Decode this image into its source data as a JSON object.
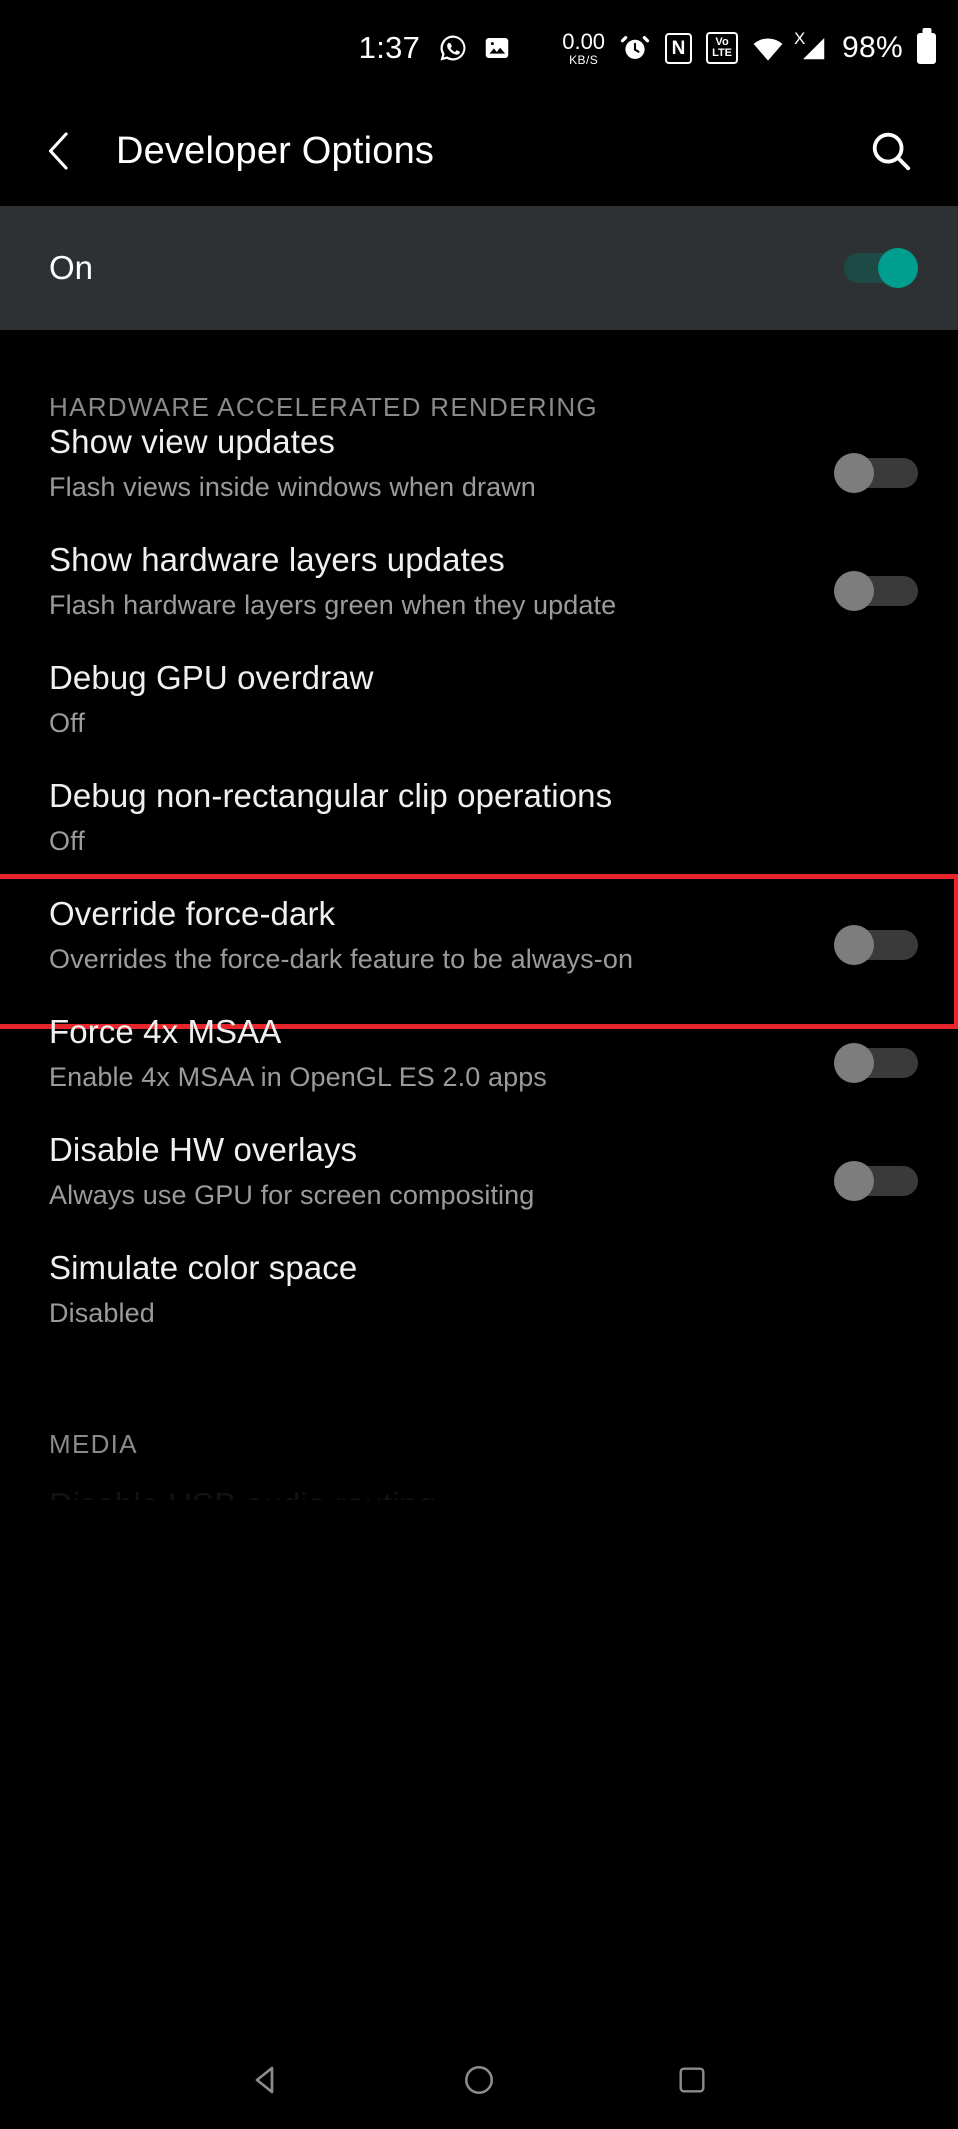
{
  "status_bar": {
    "time": "1:37",
    "net_speed_value": "0.00",
    "net_speed_unit": "KB/S",
    "nfc_label": "N",
    "volte_top": "Vo",
    "volte_bottom": "LTE",
    "signal_x": "X",
    "battery_percent": "98%",
    "icons": [
      "whatsapp-icon",
      "gallery-icon",
      "alarm-icon",
      "nfc-icon",
      "volte-icon",
      "wifi-icon",
      "cellular-signal-icon",
      "battery-icon"
    ]
  },
  "app_bar": {
    "back_icon": "back-chevron-icon",
    "title": "Developer Options",
    "search_icon": "search-icon"
  },
  "master_switch": {
    "label": "On",
    "state": "on",
    "track_color": "#1d4a45",
    "thumb_color": "#009e8e",
    "row_background": "#2e3133"
  },
  "sections": [
    {
      "header": "HARDWARE ACCELERATED RENDERING",
      "items": [
        {
          "title": "Show view updates",
          "subtitle": "Flash views inside windows when drawn",
          "control": "toggle",
          "state": "off",
          "highlighted": false
        },
        {
          "title": "Show hardware layers updates",
          "subtitle": "Flash hardware layers green when they update",
          "control": "toggle",
          "state": "off",
          "highlighted": false
        },
        {
          "title": "Debug GPU overdraw",
          "subtitle": "Off",
          "control": "none",
          "state": "",
          "highlighted": false
        },
        {
          "title": "Debug non-rectangular clip operations",
          "subtitle": "Off",
          "control": "none",
          "state": "",
          "highlighted": false
        },
        {
          "title": "Override force-dark",
          "subtitle": "Overrides the force-dark feature to be always-on",
          "control": "toggle",
          "state": "off",
          "highlighted": true
        },
        {
          "title": "Force 4x MSAA",
          "subtitle": "Enable 4x MSAA in OpenGL ES 2.0 apps",
          "control": "toggle",
          "state": "off",
          "highlighted": false
        },
        {
          "title": "Disable HW overlays",
          "subtitle": "Always use GPU for screen compositing",
          "control": "toggle",
          "state": "off",
          "highlighted": false
        },
        {
          "title": "Simulate color space",
          "subtitle": "Disabled",
          "control": "none",
          "state": "",
          "highlighted": false
        }
      ]
    },
    {
      "header": "MEDIA",
      "items": [
        {
          "title": "Disable USB audio routing",
          "subtitle": "",
          "control": "none",
          "state": "",
          "highlighted": false,
          "clipped": true
        }
      ]
    }
  ],
  "highlight": {
    "color": "#e8252a",
    "target": "Override force-dark"
  },
  "nav_bar": {
    "back": "back-triangle-icon",
    "home": "home-circle-icon",
    "recents": "recents-square-icon"
  }
}
